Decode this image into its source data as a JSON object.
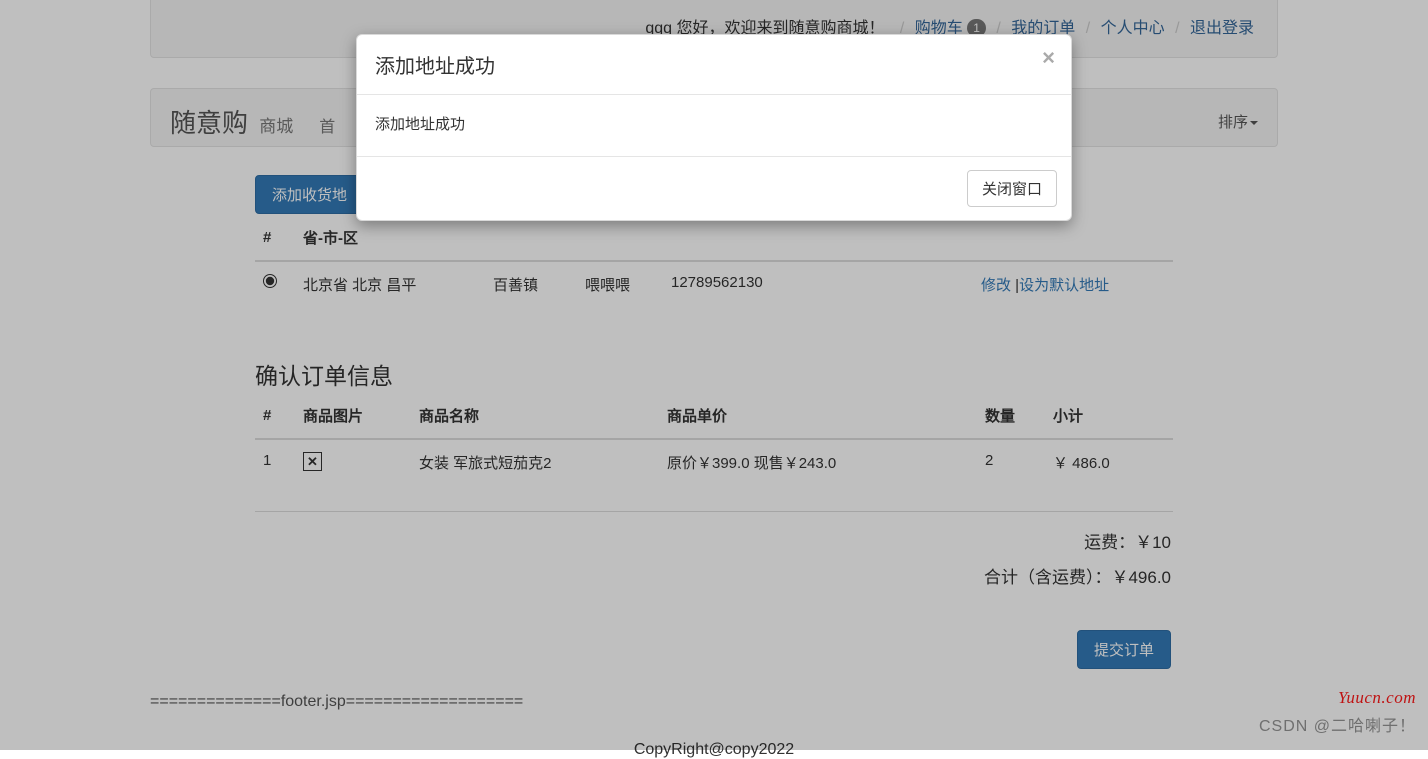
{
  "topbar": {
    "greeting": "qqq 您好，欢迎来到随意购商城！",
    "cart_label": "购物车",
    "cart_count": "1",
    "orders_label": "我的订单",
    "profile_label": "个人中心",
    "logout_label": "退出登录"
  },
  "brand": {
    "name": "随意购",
    "suffix": "商城",
    "home": "首",
    "sort_label": "排序"
  },
  "buttons": {
    "add_address": "添加收货地",
    "submit_order": "提交订单"
  },
  "address_table": {
    "headers": {
      "num": "#",
      "region": "省-市-区",
      "detail_partial": "",
      "consignee_partial": "",
      "phone_partial": ""
    },
    "rows": [
      {
        "region": "北京省 北京 昌平",
        "detail": "百善镇",
        "consignee": "喂喂喂",
        "phone": "12789562130",
        "edit_label": "修改",
        "sep": " |",
        "default_label": "设为默认地址"
      }
    ]
  },
  "order_section": {
    "title": "确认订单信息",
    "headers": {
      "num": "#",
      "image": "商品图片",
      "name": "商品名称",
      "price": "商品单价",
      "qty": "数量",
      "subtotal": "小计"
    },
    "rows": [
      {
        "num": "1",
        "image_icon": "✕",
        "name": "女装 军旅式短茄克2",
        "price": "原价￥399.0   现售￥243.0",
        "qty": "2",
        "subtotal": "￥ 486.0"
      }
    ],
    "shipping_label": "运费：￥10",
    "total_label": "合计（含运费）：￥496.0"
  },
  "footer": {
    "marker": "==============footer.jsp===================",
    "copyright": "CopyRight@copy2022"
  },
  "modal": {
    "title": "添加地址成功",
    "body": "添加地址成功",
    "close_btn": "关闭窗口"
  },
  "watermark": {
    "site": "Yuucn.com",
    "csdn": "CSDN @二哈喇子！"
  }
}
